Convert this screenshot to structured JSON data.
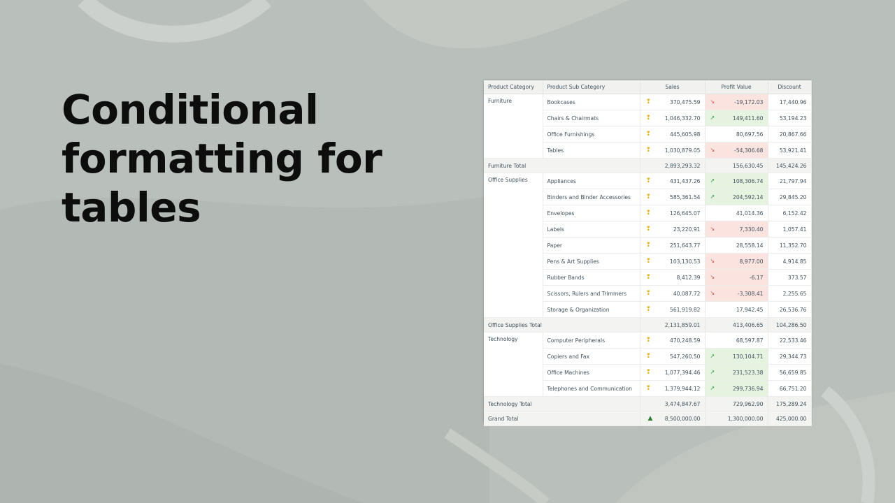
{
  "title_lines": [
    "Conditional",
    "formatting for",
    "tables"
  ],
  "colors": {
    "positive_fill": "#e7f3e1",
    "negative_fill": "#fbe4e0",
    "sales_indicator": "#e6b72c"
  },
  "table": {
    "headers": [
      "Product Category",
      "Product Sub Category",
      "Sales",
      "Profit Value",
      "Discount"
    ],
    "rows": [
      {
        "cat": "Furniture",
        "sub": "Bookcases",
        "sales": "370,475.59",
        "profit": "-19,172.03",
        "trend": "down",
        "discount": "17,440.96"
      },
      {
        "cat": "",
        "sub": "Chairs & Chairmats",
        "sales": "1,046,332.70",
        "profit": "149,411.60",
        "trend": "up",
        "discount": "53,194.23"
      },
      {
        "cat": "",
        "sub": "Office Furnishings",
        "sales": "445,605.98",
        "profit": "80,697.56",
        "trend": "none",
        "discount": "20,867.66"
      },
      {
        "cat": "",
        "sub": "Tables",
        "sales": "1,030,879.05",
        "profit": "-54,306.68",
        "trend": "down",
        "discount": "53,921.41"
      },
      {
        "type": "subtotal",
        "label": "Furniture Total",
        "sales": "2,893,293.32",
        "profit": "156,630.45",
        "discount": "145,424.26"
      },
      {
        "cat": "Office Supplies",
        "sub": "Appliances",
        "sales": "431,437.26",
        "profit": "108,306.74",
        "trend": "up",
        "discount": "21,797.94"
      },
      {
        "cat": "",
        "sub": "Binders and Binder Accessories",
        "sales": "585,361.54",
        "profit": "204,592.14",
        "trend": "up",
        "discount": "29,845.20"
      },
      {
        "cat": "",
        "sub": "Envelopes",
        "sales": "126,645.07",
        "profit": "41,014.36",
        "trend": "none",
        "discount": "6,152.42"
      },
      {
        "cat": "",
        "sub": "Labels",
        "sales": "23,220.91",
        "profit": "7,330.40",
        "trend": "down",
        "discount": "1,057.41"
      },
      {
        "cat": "",
        "sub": "Paper",
        "sales": "251,643.77",
        "profit": "28,558.14",
        "trend": "none",
        "discount": "11,352.70"
      },
      {
        "cat": "",
        "sub": "Pens & Art Supplies",
        "sales": "103,130.53",
        "profit": "8,977.00",
        "trend": "down",
        "discount": "4,914.85"
      },
      {
        "cat": "",
        "sub": "Rubber Bands",
        "sales": "8,412.39",
        "profit": "-6.17",
        "trend": "down",
        "discount": "373.57"
      },
      {
        "cat": "",
        "sub": "Scissors, Rulers and Trimmers",
        "sales": "40,087.72",
        "profit": "-3,308.41",
        "trend": "down",
        "discount": "2,255.65"
      },
      {
        "cat": "",
        "sub": "Storage & Organization",
        "sales": "561,919.82",
        "profit": "17,942.45",
        "trend": "none",
        "discount": "26,536.76"
      },
      {
        "type": "subtotal",
        "label": "Office Supplies Total",
        "sales": "2,131,859.01",
        "profit": "413,406.65",
        "discount": "104,286.50"
      },
      {
        "cat": "Technology",
        "sub": "Computer Peripherals",
        "sales": "470,248.59",
        "profit": "68,597.87",
        "trend": "none",
        "discount": "22,533.46"
      },
      {
        "cat": "",
        "sub": "Copiers and Fax",
        "sales": "547,260.50",
        "profit": "130,104.71",
        "trend": "up",
        "discount": "29,344.73"
      },
      {
        "cat": "",
        "sub": "Office Machines",
        "sales": "1,077,394.46",
        "profit": "231,523.38",
        "trend": "up",
        "discount": "56,659.85"
      },
      {
        "cat": "",
        "sub": "Telephones and Communication",
        "sales": "1,379,944.12",
        "profit": "299,736.94",
        "trend": "up",
        "discount": "66,751.20"
      },
      {
        "type": "subtotal",
        "label": "Technology Total",
        "sales": "3,474,847.67",
        "profit": "729,962.90",
        "discount": "175,289.24"
      },
      {
        "type": "grand",
        "label": "Grand Total",
        "sales": "8,500,000.00",
        "profit": "1,300,000.00",
        "discount": "425,000.00"
      }
    ]
  }
}
